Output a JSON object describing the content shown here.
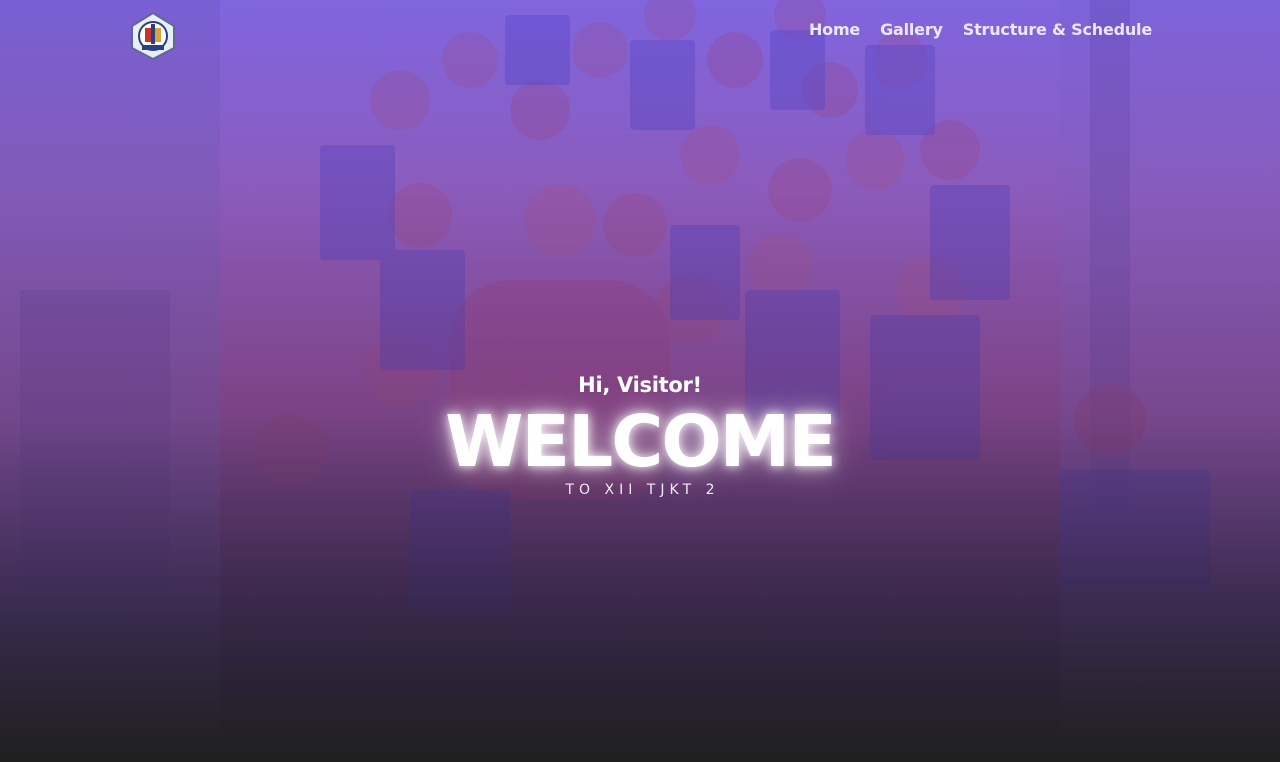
{
  "page": {
    "background_color": "#1f1f1f",
    "overlay_top_color": "#7850e6",
    "overlay_bottom_color": "#1f1f1f"
  },
  "navbar": {
    "logo_icon": "school-emblem-icon",
    "links": [
      {
        "label": "Home"
      },
      {
        "label": "Gallery"
      },
      {
        "label": "Structure & Schedule"
      }
    ]
  },
  "hero": {
    "background_image": "class-group-photo",
    "greeting": "Hi, Visitor!",
    "headline": "WELCOME",
    "subline": "TO XII TJKT 2"
  }
}
